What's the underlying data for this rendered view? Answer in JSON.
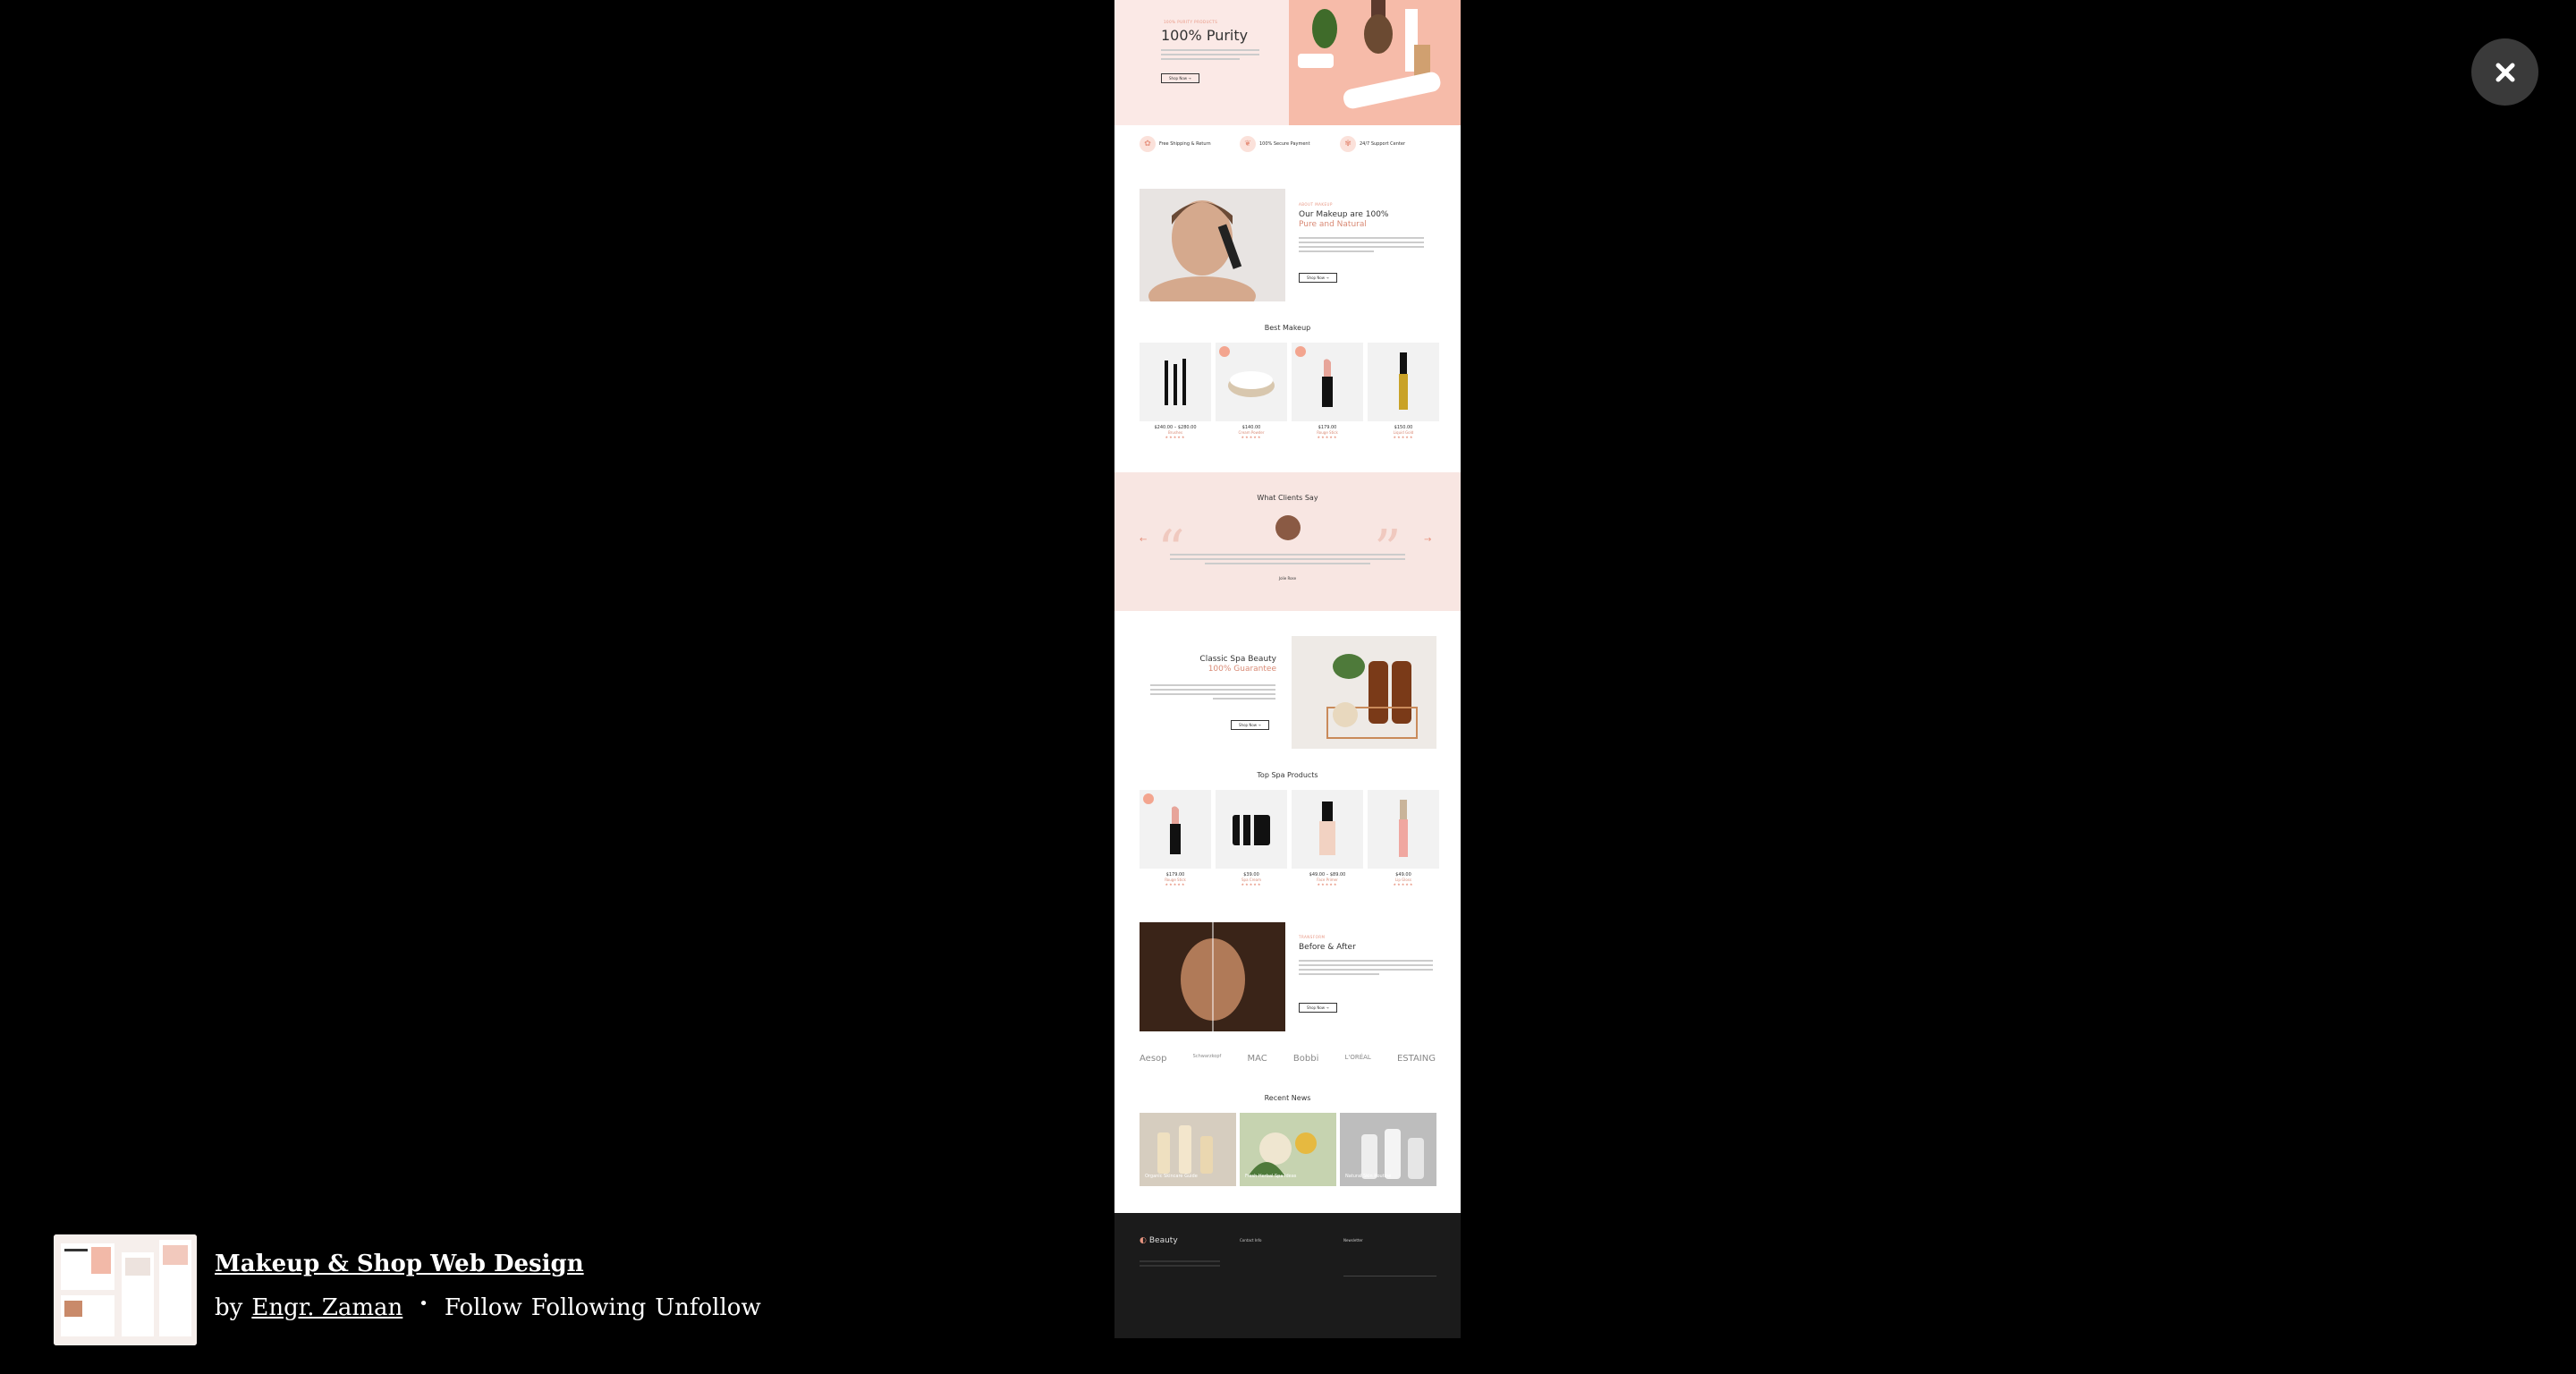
{
  "modal": {
    "close_label": "×"
  },
  "project": {
    "title": "Makeup & Shop Web Design",
    "by": "by",
    "author": "Engr. Zaman",
    "separator": "•",
    "follow_actions": [
      "Follow",
      "Following",
      "Unfollow"
    ]
  },
  "shot": {
    "hero": {
      "eyebrow": "100% PURITY PRODUCTS",
      "title": "100% Purity",
      "button": "Shop Now →"
    },
    "features": [
      "Free Shipping & Return",
      "100% Secure Payment",
      "24/7 Support Center"
    ],
    "about": {
      "eyebrow": "ABOUT MAKEUP",
      "title_line1": "Our Makeup are 100%",
      "title_line2": "Pure and Natural",
      "button": "Shop Now →"
    },
    "best_makeup": {
      "title": "Best Makeup",
      "products": [
        {
          "price": "$240.00 – $280.00",
          "name": "Brushes"
        },
        {
          "price": "$140.00",
          "name": "Cream Powder"
        },
        {
          "price": "$179.00",
          "name": "Rouge Stick"
        },
        {
          "price": "$150.00",
          "name": "Liquid Gold"
        }
      ]
    },
    "testimonial": {
      "title": "What Clients Say",
      "author": "Jolie Rose"
    },
    "spa": {
      "title_line1": "Classic Spa Beauty",
      "title_line2": "100% Guarantee",
      "button": "Shop Now →"
    },
    "top_spa": {
      "title": "Top Spa Products",
      "products": [
        {
          "price": "$179.00",
          "name": "Rouge Stick"
        },
        {
          "price": "$39.00",
          "name": "Spa Cream"
        },
        {
          "price": "$49.00 – $89.00",
          "name": "Face Primer"
        },
        {
          "price": "$49.00",
          "name": "Lip Gloss"
        }
      ]
    },
    "before_after": {
      "eyebrow": "TRANSFORM",
      "title": "Before & After",
      "button": "Shop Now →"
    },
    "brands": [
      "Aesop",
      "Schwarzkopf",
      "MAC",
      "Bobbi",
      "L'ORÉAL",
      "ESTAING"
    ],
    "recent_news": {
      "title": "Recent News",
      "cards": [
        "Organic Skincare Guide",
        "Fresh Herbal Spa Ideas",
        "Natural Skin Routine"
      ]
    },
    "footer": {
      "brand": "Beauty",
      "col1": "Contact Info",
      "col2": "Newsletter"
    }
  }
}
